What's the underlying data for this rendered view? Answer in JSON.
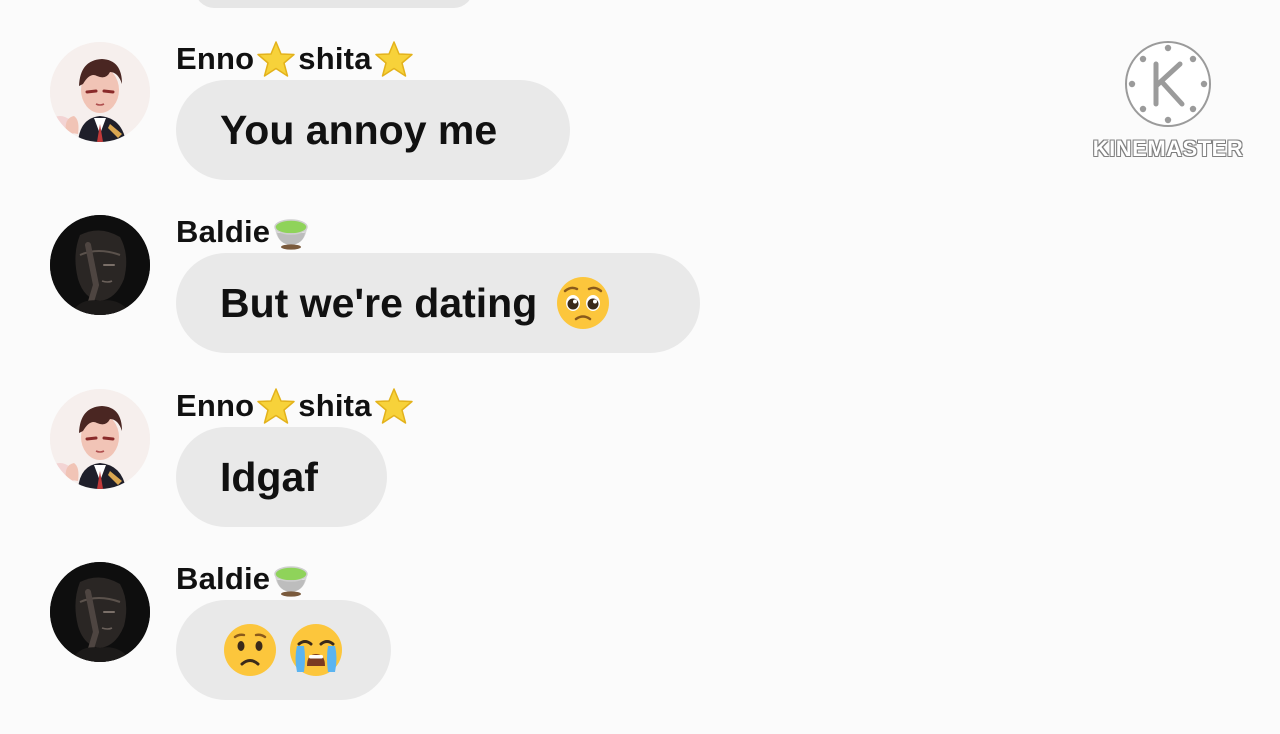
{
  "watermark": {
    "text": "KINEMASTER",
    "icon": "kinemaster-logo-icon"
  },
  "colors": {
    "bubble": "#e9e9e9",
    "background": "#fbfbfb",
    "text": "#111111"
  },
  "messages": [
    {
      "sender": "Enno",
      "sender_suffix": "shita",
      "sender_icons": [
        "star-icon",
        "star-icon"
      ],
      "avatar": "enno-avatar",
      "text": "You annoy me",
      "emojis": []
    },
    {
      "sender": "Baldie",
      "sender_suffix": "",
      "sender_icons": [
        "green-tea-icon"
      ],
      "avatar": "baldie-avatar",
      "text": "But we're dating",
      "emojis": [
        "pleading-face-icon"
      ]
    },
    {
      "sender": "Enno",
      "sender_suffix": "shita",
      "sender_icons": [
        "star-icon",
        "star-icon"
      ],
      "avatar": "enno-avatar",
      "text": "Idgaf",
      "emojis": []
    },
    {
      "sender": "Baldie",
      "sender_suffix": "",
      "sender_icons": [
        "green-tea-icon"
      ],
      "avatar": "baldie-avatar",
      "text": "",
      "emojis": [
        "frowning-face-icon",
        "crying-face-icon"
      ]
    }
  ]
}
